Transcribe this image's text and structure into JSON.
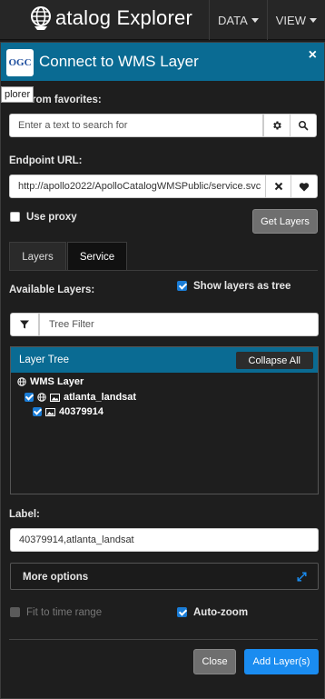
{
  "topbar": {
    "app_title": "atalog Explorer",
    "nav": [
      {
        "label": "DATA"
      },
      {
        "label": "VIEW"
      }
    ]
  },
  "dialog": {
    "title": "Connect to WMS Layer",
    "logo_text": "OGC",
    "close_glyph": "×",
    "tooltip": "plorer",
    "favorites_label": "rom favorites:",
    "favorites_placeholder": "Enter a text to search for",
    "endpoint_label": "Endpoint URL:",
    "endpoint_value": "http://apollo2022/ApolloCatalogWMSPublic/service.svc",
    "use_proxy_label": "Use proxy",
    "use_proxy_checked": false,
    "get_layers_label": "Get Layers",
    "tabs": [
      {
        "label": "Layers",
        "active": false
      },
      {
        "label": "Service",
        "active": true
      }
    ],
    "available_layers_label": "Available Layers:",
    "show_as_tree_label": "Show layers as tree",
    "show_as_tree_checked": true,
    "tree_filter_placeholder": "Tree Filter",
    "layer_tree": {
      "title": "Layer Tree",
      "collapse_label": "Collapse All",
      "root": "WMS Layer",
      "child": "atlanta_landsat",
      "grandchild": "40379914"
    },
    "layer_label_caption": "Label:",
    "layer_label_value": "40379914,atlanta_landsat",
    "more_options_label": "More options",
    "fit_time_label": "Fit to time range",
    "fit_time_checked": false,
    "auto_zoom_label": "Auto-zoom",
    "auto_zoom_checked": true,
    "close_label": "Close",
    "add_layers_label": "Add Layer(s)"
  },
  "colors": {
    "header_blue": "#0a6b93",
    "primary_button": "#1a8cf0",
    "checkbox_blue": "#1a7cd6"
  },
  "icons": [
    "globe-icon",
    "caret-down-icon",
    "ogc-logo",
    "close-icon",
    "gear-icon",
    "search-icon",
    "clear-icon",
    "heart-icon",
    "filter-icon",
    "image-icon",
    "expand-icon"
  ]
}
